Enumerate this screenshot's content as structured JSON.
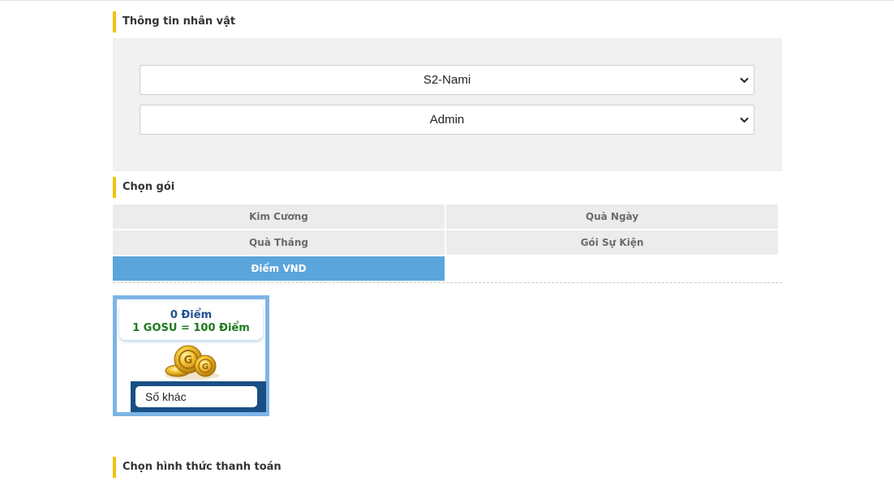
{
  "character_section": {
    "heading": "Thông tin nhân vật",
    "server_select": {
      "selected": "S2-Nami"
    },
    "character_select": {
      "selected": "Admin"
    }
  },
  "package_section": {
    "heading": "Chọn gói",
    "tabs": [
      {
        "label": "Kim Cương",
        "active": false
      },
      {
        "label": "Quà Ngày",
        "active": false
      },
      {
        "label": "Quà Tháng",
        "active": false
      },
      {
        "label": "Gói Sự Kiện",
        "active": false
      },
      {
        "label": "Điểm VND",
        "active": true
      }
    ],
    "card": {
      "points": "0 Điểm",
      "rate": "1 GOSU = 100 Điểm",
      "other_amount": "Số khác",
      "icon": "gold-coins-icon"
    }
  },
  "payment_section": {
    "heading": "Chọn hình thức thanh toán"
  },
  "colors": {
    "heading_accent": "#f2c20e",
    "active_tab": "#5aa5dc",
    "card_border": "#7db4e6",
    "card_footer": "#1a4f86",
    "points_text": "#1f4f8f",
    "rate_text": "#1d7a1d"
  }
}
